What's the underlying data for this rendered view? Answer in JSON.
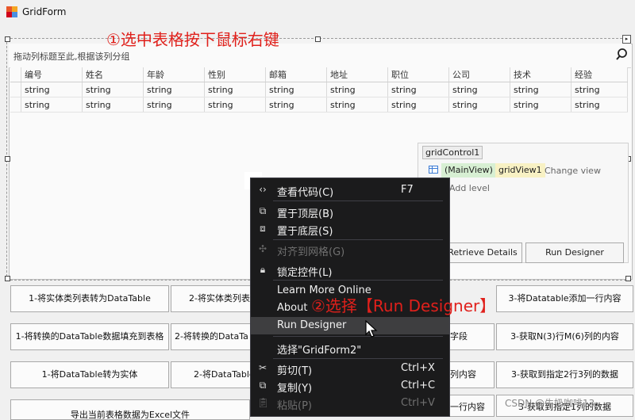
{
  "window": {
    "title": "GridForm"
  },
  "annotations": {
    "step1": "①选中表格按下鼠标右键",
    "step2": "②选择【Run Designer】"
  },
  "grid": {
    "group_panel_text": "拖动列标题至此,根据该列分组",
    "columns": [
      "编号",
      "姓名",
      "年龄",
      "性别",
      "邮箱",
      "地址",
      "职位",
      "公司",
      "技术",
      "经验"
    ],
    "rows": [
      [
        "string",
        "string",
        "string",
        "string",
        "string",
        "string",
        "string",
        "string",
        "string",
        "string"
      ],
      [
        "string",
        "string",
        "string",
        "string",
        "string",
        "string",
        "string",
        "string",
        "string",
        "string"
      ]
    ]
  },
  "level_designer": {
    "control_name": "gridControl1",
    "main_view": "(MainView)",
    "view_name": "gridView1",
    "change_view": "Change view",
    "add_level": "Add level",
    "retrieve_details": "Retrieve Details",
    "run_designer": "Run Designer"
  },
  "buttons": {
    "b1": "1-将实体类列表转为DataTable",
    "b2": "2-将实体类列表",
    "b3": "3-将Datatable添加一行内容",
    "b4": "1-将转换的DataTable数据填充到表格",
    "b5": "2-将转换的DataTa",
    "b6": "字段",
    "b7": "3-获取N(3)行M(6)列的内容",
    "b8": "1-将DataTable转为实体",
    "b9": "2-将DataTable",
    "b10": "列内容",
    "b11": "3-获取到指定2行3列的数据",
    "b12": "一行内容",
    "b13": "3-获取到指定1列的数据",
    "b14": "导出当前表格数据为Excel文件"
  },
  "context_menu": {
    "view_code": {
      "label": "查看代码(C)",
      "shortcut": "F7"
    },
    "bring_front": {
      "label": "置于顶层(B)"
    },
    "send_back": {
      "label": "置于底层(S)"
    },
    "align_grid": {
      "label": "对齐到网格(G)"
    },
    "lock_controls": {
      "label": "锁定控件(L)"
    },
    "learn_more": {
      "label": "Learn More Online"
    },
    "about": {
      "label": "About"
    },
    "run_designer": {
      "label": "Run Designer"
    },
    "select_form": {
      "label": "选择\"GridForm2\""
    },
    "cut": {
      "label": "剪切(T)",
      "shortcut": "Ctrl+X"
    },
    "copy": {
      "label": "复制(Y)",
      "shortcut": "Ctrl+C"
    },
    "paste": {
      "label": "粘贴(P)",
      "shortcut": "Ctrl+V"
    }
  },
  "watermark": "CSDN @牛奶咖啡13"
}
